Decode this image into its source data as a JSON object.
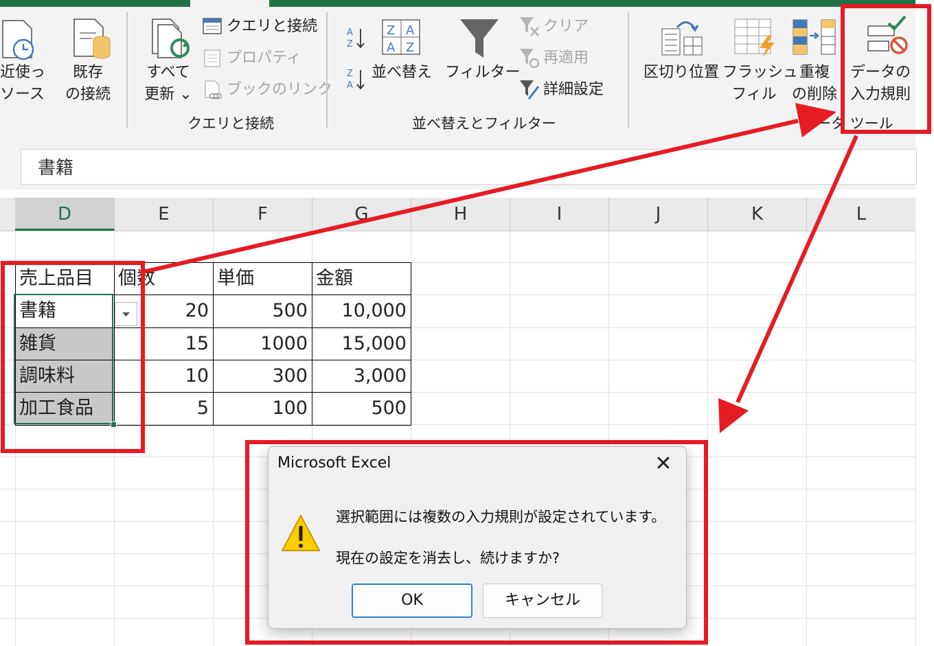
{
  "ribbon": {
    "partial_left": {
      "line1": "近使っ",
      "line2": "ソース"
    },
    "existing_connections": {
      "line1": "既存",
      "line2": "の接続"
    },
    "refresh_all": {
      "line1": "すべて",
      "line2": "更新 ⌄"
    },
    "queries_connections": "クエリと接続",
    "properties": "プロパティ",
    "edit_links": "ブックのリンク",
    "group_queries": "クエリと接続",
    "sort_az_icon": "A↓Z",
    "sort_za_icon": "Z↓A",
    "sort": "並べ替え",
    "filter": "フィルター",
    "clear": "クリア",
    "reapply": "再適用",
    "advanced": "詳細設定",
    "group_sort_filter": "並べ替えとフィルター",
    "text_to_columns": "区切り位置",
    "flash_fill": {
      "line1": "フラッシュ",
      "line2": "フィル"
    },
    "remove_duplicates": {
      "line1": "重複",
      "line2": "の削除"
    },
    "data_validation": {
      "line1": "データの",
      "line2": "入力規則"
    },
    "group_data_tools": "データ ツール"
  },
  "formula_bar": {
    "value": "書籍"
  },
  "columns": [
    "D",
    "E",
    "F",
    "G",
    "H",
    "I",
    "J",
    "K",
    "L"
  ],
  "table": {
    "headers": [
      "売上品目",
      "個数",
      "単価",
      "金額"
    ],
    "rows": [
      [
        "書籍",
        "20",
        "500",
        "10,000"
      ],
      [
        "雑貨",
        "15",
        "1000",
        "15,000"
      ],
      [
        "調味料",
        "10",
        "300",
        "3,000"
      ],
      [
        "加工食品",
        "5",
        "100",
        "500"
      ]
    ]
  },
  "dialog": {
    "title": "Microsoft Excel",
    "close": "✕",
    "message1": "選択範囲には複数の入力規則が設定されています。",
    "message2": "現在の設定を消去し、続けますか?",
    "ok": "OK",
    "cancel": "キャンセル"
  },
  "colors": {
    "excel_green": "#217346",
    "annotation_red": "#e51c23",
    "selection_gray": "#c8c8c8"
  }
}
